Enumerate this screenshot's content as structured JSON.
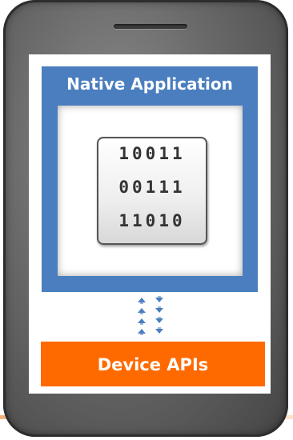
{
  "diagram": {
    "native_label": "Native Application",
    "binary_rows": [
      "10011",
      "00111",
      "11010"
    ],
    "device_label": "Device APIs",
    "colors": {
      "native_box": "#4a7ebf",
      "device_box": "#ff6a00",
      "phone_body": "#6a6a6a",
      "accent_line": "#f2b27a"
    }
  }
}
